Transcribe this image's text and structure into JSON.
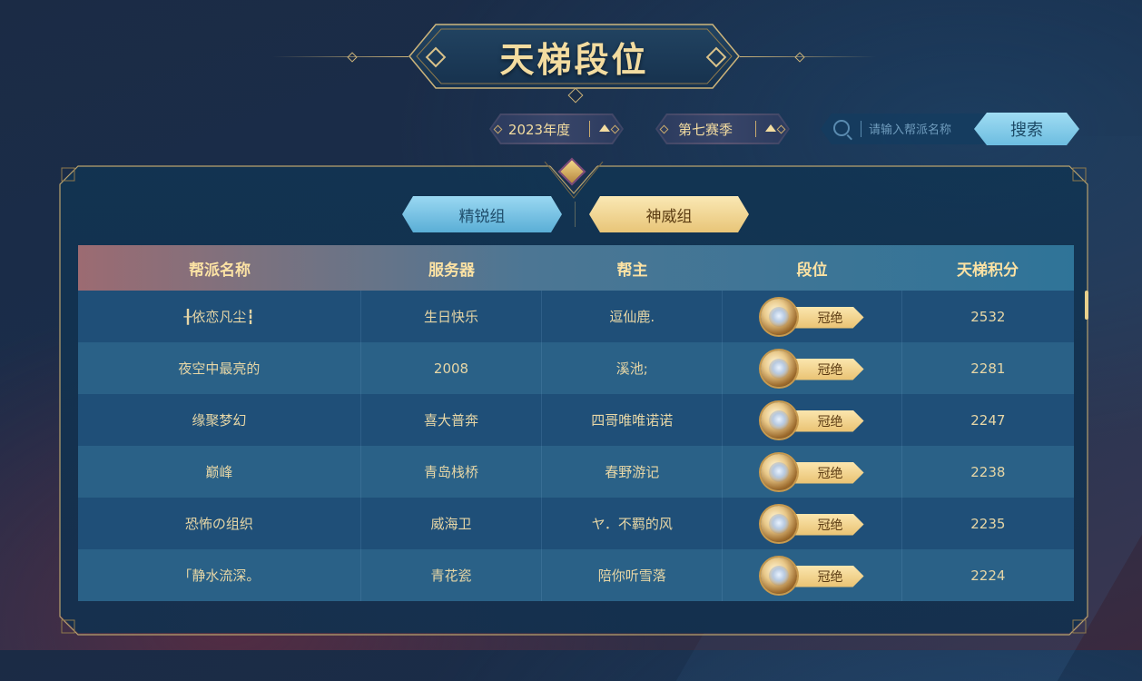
{
  "title": "天梯段位",
  "filters": {
    "year": "2023年度",
    "season": "第七赛季",
    "search_placeholder": "请输入帮派名称",
    "search_button": "搜索"
  },
  "tabs": [
    {
      "label": "精锐组",
      "active": false
    },
    {
      "label": "神威组",
      "active": true
    }
  ],
  "table": {
    "headers": [
      "帮派名称",
      "服务器",
      "帮主",
      "段位",
      "天梯积分"
    ],
    "rows": [
      {
        "guild": "╂依恋凡尘┇",
        "server": "生日快乐",
        "leader": "逗仙鹿.",
        "rank": "冠绝",
        "score": "2532"
      },
      {
        "guild": "夜空中最亮的",
        "server": "2008",
        "leader": "溪池;",
        "rank": "冠绝",
        "score": "2281"
      },
      {
        "guild": "缘聚梦幻",
        "server": "喜大普奔",
        "leader": "四哥唯唯诺诺",
        "rank": "冠绝",
        "score": "2247"
      },
      {
        "guild": "巅峰",
        "server": "青岛栈桥",
        "leader": "春野游记",
        "rank": "冠绝",
        "score": "2238"
      },
      {
        "guild": "恐怖の组织",
        "server": "威海卫",
        "leader": "ヤ．不羁的风",
        "rank": "冠绝",
        "score": "2235"
      },
      {
        "guild": "「静水流深。",
        "server": "青花瓷",
        "leader": "陪你听雪落",
        "rank": "冠绝",
        "score": "2224"
      }
    ]
  },
  "colors": {
    "gold_text": "#f3dca0",
    "elite_tab": "#7cc6e8",
    "divine_tab": "#efd08e",
    "row_dark": "#1f4f78",
    "row_light": "#2a6187"
  }
}
